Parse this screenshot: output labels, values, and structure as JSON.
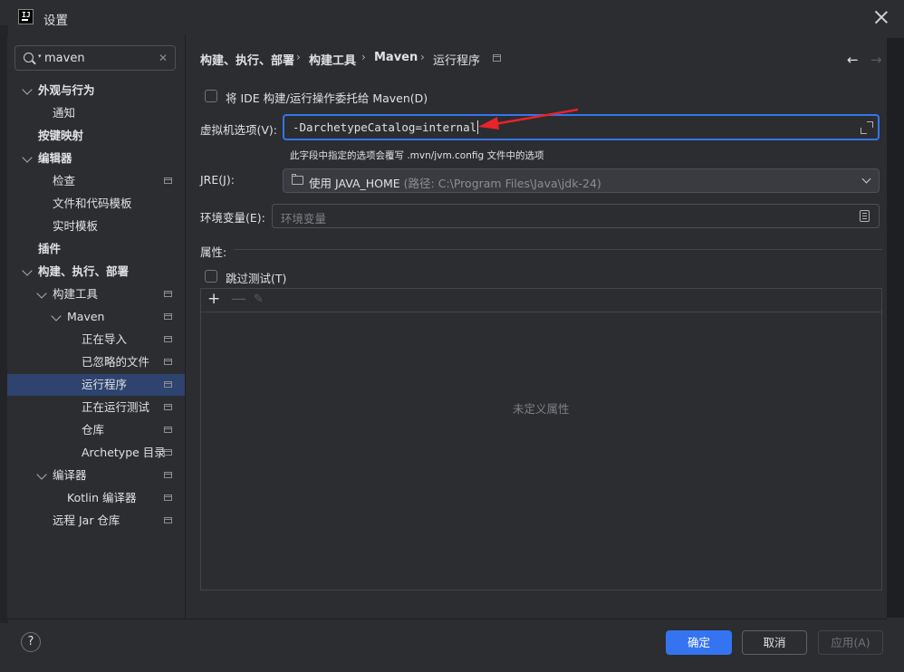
{
  "window": {
    "title": "设置"
  },
  "search": {
    "value": "maven"
  },
  "tree": [
    {
      "label": "外观与行为"
    },
    {
      "label": "通知"
    },
    {
      "label": "按键映射"
    },
    {
      "label": "编辑器"
    },
    {
      "label": "检查"
    },
    {
      "label": "文件和代码模板"
    },
    {
      "label": "实时模板"
    },
    {
      "label": "插件"
    },
    {
      "label": "构建、执行、部署"
    },
    {
      "label": "构建工具"
    },
    {
      "label": "Maven"
    },
    {
      "label": "正在导入"
    },
    {
      "label": "已忽略的文件"
    },
    {
      "label": "运行程序"
    },
    {
      "label": "正在运行测试"
    },
    {
      "label": "仓库"
    },
    {
      "label": "Archetype 目录"
    },
    {
      "label": "编译器"
    },
    {
      "label": "Kotlin 编译器"
    },
    {
      "label": "远程 Jar 仓库"
    }
  ],
  "breadcrumb": {
    "items": [
      "构建、执行、部署",
      "构建工具",
      "Maven",
      "运行程序"
    ],
    "separator": "›"
  },
  "nav": {
    "back": "←",
    "forward": "→"
  },
  "form": {
    "delegate_label": "将 IDE 构建/运行操作委托给 Maven(D)",
    "vm_label": "虚拟机选项(V):",
    "vm_value": "-DarchetypeCatalog=internal",
    "vm_hint": "此字段中指定的选项会覆写 .mvn/jvm.config 文件中的选项",
    "jre_label": "JRE(J):",
    "jre_value": "使用 JAVA_HOME",
    "jre_path": "(路径: C:\\Program Files\\Java\\jdk-24)",
    "env_label": "环境变量(E):",
    "env_placeholder": "环境变量",
    "props_label": "属性:",
    "skip_tests_label": "跳过测试(T)",
    "props_empty": "未定义属性"
  },
  "buttons": {
    "ok": "确定",
    "cancel": "取消",
    "apply": "应用(A)",
    "help": "?"
  },
  "colors": {
    "accent": "#3574f0",
    "selection": "#2e436e",
    "annotation_arrow": "#e8232a"
  }
}
